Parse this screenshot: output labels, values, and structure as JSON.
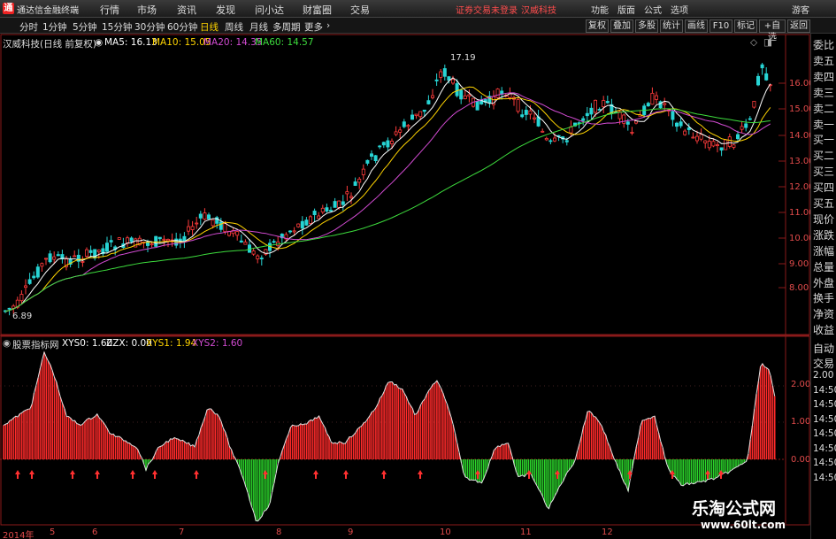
{
  "app": {
    "title": "通达信金融终端",
    "menus": [
      "行情",
      "市场",
      "资讯",
      "发现",
      "问小达",
      "财富圈",
      "交易"
    ],
    "notice": "证券交易未登录",
    "stock": "汉威科技",
    "right_menus": [
      "功能",
      "版面",
      "公式",
      "选项"
    ],
    "guest": "游客"
  },
  "periods": {
    "items": [
      "分时",
      "1分钟",
      "5分钟",
      "15分钟",
      "30分钟",
      "60分钟",
      "日线",
      "周线",
      "月线",
      "多周期",
      "更多"
    ],
    "active": "日线"
  },
  "right_buttons": [
    "复权",
    "叠加",
    "多股",
    "统计",
    "画线",
    "F10",
    "标记",
    "+自选",
    "返回"
  ],
  "main_legend": {
    "name": "汉威科技(日线 前复权)",
    "ma5": "MA5: 16.13",
    "ma10": "MA10: 15.05",
    "ma20": "MA20: 14.35",
    "ma60": "MA60: 14.57",
    "colors": {
      "ma5": "#ffffff",
      "ma10": "#ffd400",
      "ma20": "#d24bd2",
      "ma60": "#3ddc3d"
    }
  },
  "price_axis": [
    "16.00",
    "15.00",
    "14.00",
    "13.00",
    "12.00",
    "11.00",
    "10.00",
    "9.00",
    "8.00"
  ],
  "annotations": {
    "high": "17.19",
    "low": "6.89"
  },
  "indicator_legend": {
    "name": "股票指标网",
    "xys0": "XYS0: 1.60",
    "zzx": "ZZX: 0.00",
    "xys1": "XYS1: 1.94",
    "xys2": "XYS2: 1.60"
  },
  "indicator_axis": [
    "2.00",
    "1.00",
    "0.00"
  ],
  "x_labels": [
    "2014年",
    "5",
    "6",
    "7",
    "8",
    "9",
    "10",
    "11",
    "12"
  ],
  "right_panel": {
    "top": [
      "委比",
      "卖五",
      "卖四",
      "卖三",
      "卖二",
      "卖一",
      "买一",
      "买二",
      "买三",
      "买四",
      "买五",
      "现价",
      "涨跌",
      "涨幅",
      "总量",
      "外盘",
      "换手",
      "净资",
      "收益"
    ],
    "bottom": [
      "自动",
      "交易",
      "2.00",
      "14:50",
      "14:50",
      "14:50",
      "14:50",
      "14:50",
      "14:50",
      "14:50"
    ]
  },
  "watermark": {
    "title": "乐淘公式网",
    "url": "www.60lt.com"
  }
}
